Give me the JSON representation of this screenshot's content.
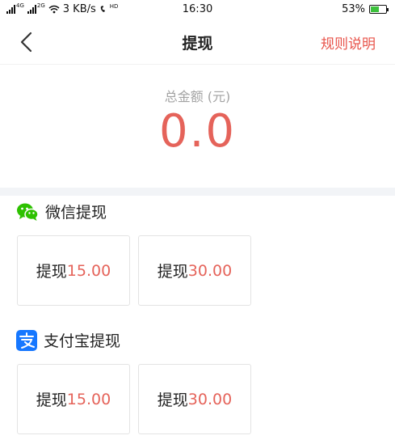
{
  "status_bar": {
    "network_a": "4G",
    "network_b": "2G",
    "speed": "3 KB/s",
    "hd": "HD",
    "time": "16:30",
    "battery": "53%",
    "battery_level": 0.53
  },
  "nav": {
    "title": "提现",
    "action": "规则说明"
  },
  "summary": {
    "label": "总金额 (元)",
    "value": "0.0"
  },
  "wechat": {
    "title": "微信提现",
    "icon": "wechat-icon",
    "color": "#2dc100",
    "options": [
      {
        "prefix": "提现",
        "amount": "15.00"
      },
      {
        "prefix": "提现",
        "amount": "30.00"
      }
    ]
  },
  "alipay": {
    "title": "支付宝提现",
    "icon": "alipay-icon",
    "color": "#1677ff",
    "options": [
      {
        "prefix": "提现",
        "amount": "15.00"
      },
      {
        "prefix": "提现",
        "amount": "30.00"
      }
    ]
  },
  "colors": {
    "accent": "#e5635a",
    "action": "#e8534a",
    "muted": "#a3a3a3",
    "divider": "#f2f4f7"
  }
}
